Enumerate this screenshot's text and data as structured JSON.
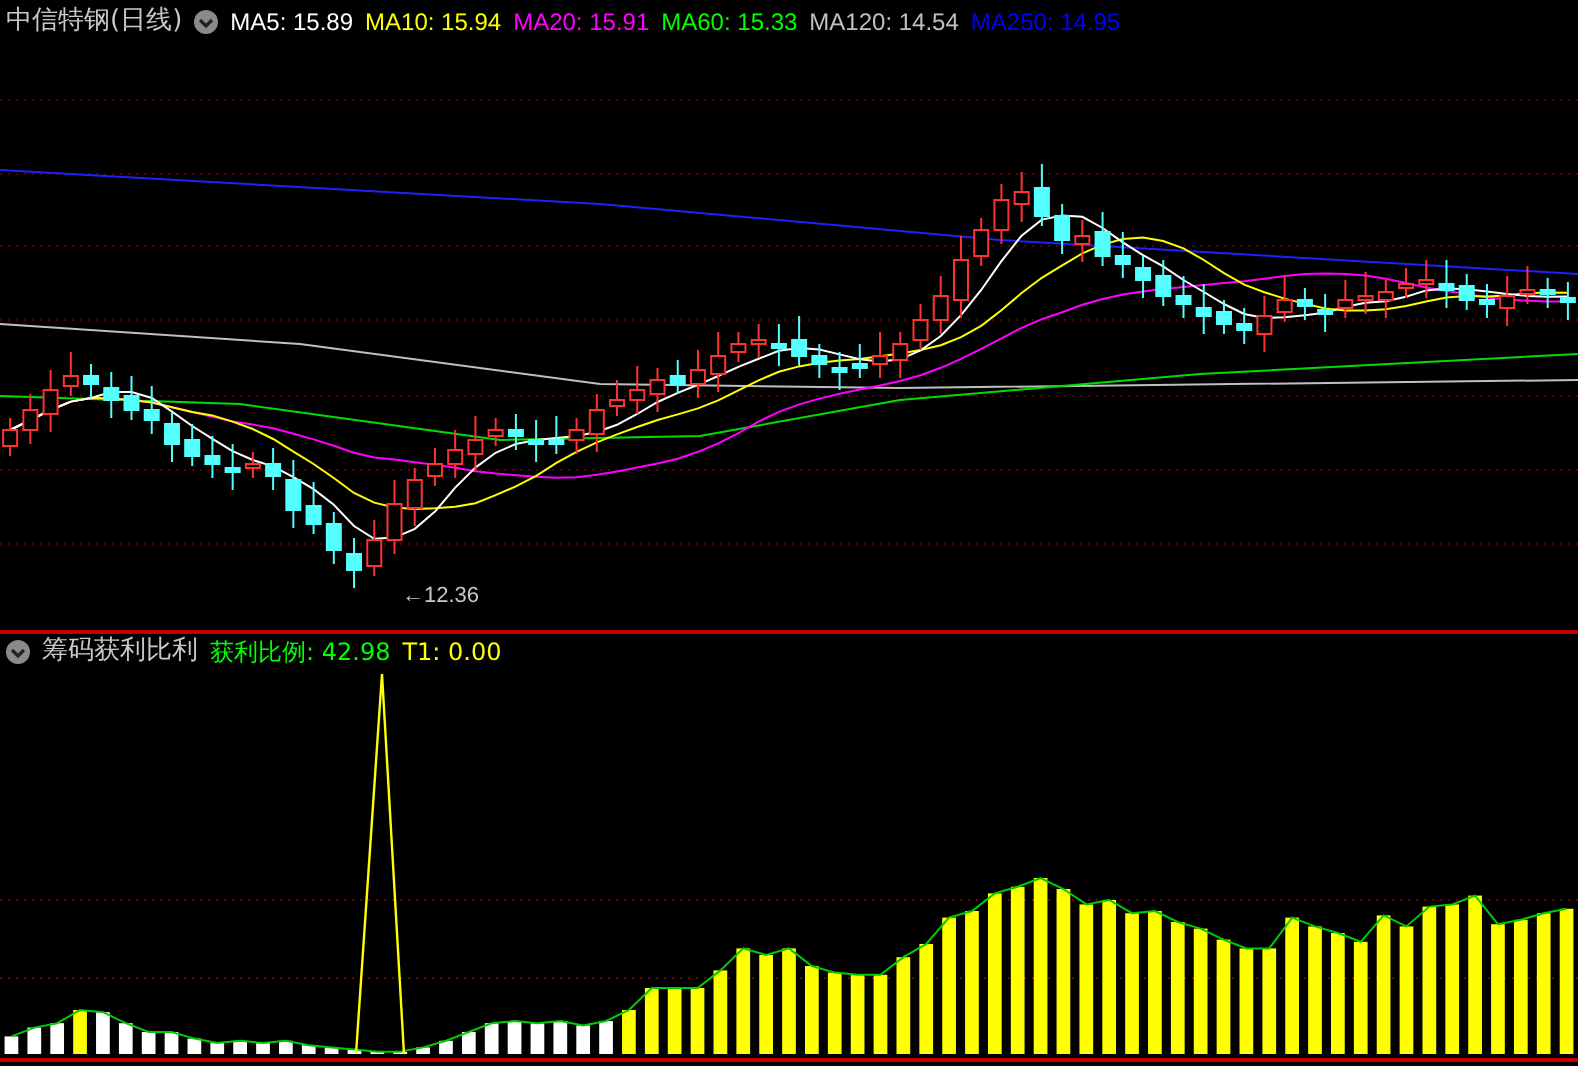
{
  "chart_header": {
    "title": "中信特钢(日线)",
    "indicators": [
      {
        "label": "MA5: 15.89",
        "color": "#ffffff"
      },
      {
        "label": "MA10: 15.94",
        "color": "#ffff00"
      },
      {
        "label": "MA20: 15.91",
        "color": "#ff00ff"
      },
      {
        "label": "MA60: 15.33",
        "color": "#00ff00"
      },
      {
        "label": "MA120: 14.54",
        "color": "#c0c0c0"
      },
      {
        "label": "MA250: 14.95",
        "color": "#0000ff"
      }
    ]
  },
  "low_price_label": "←12.36",
  "indicator_panel": {
    "title": "筹码获利比利",
    "values": [
      {
        "label": "获利比例: 42.98",
        "color": "#00ff00"
      },
      {
        "label": "T1: 0.00",
        "color": "#ffff00"
      }
    ]
  }
}
